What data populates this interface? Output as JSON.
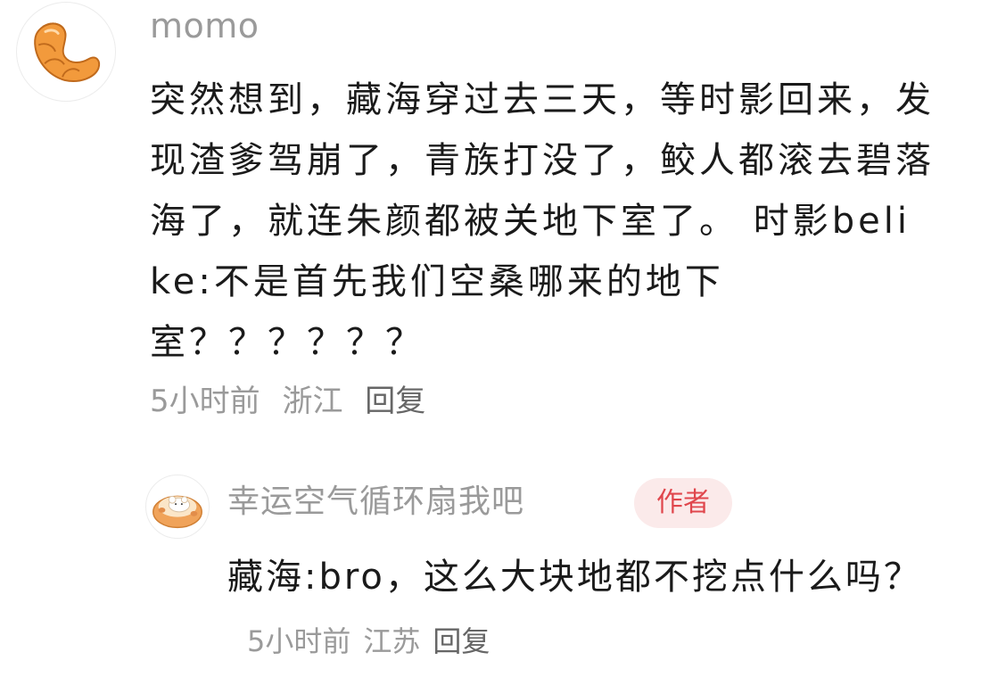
{
  "comment": {
    "username": "momo",
    "text": "突然想到，藏海穿过去三天，等时影回来，发现渣爹驾崩了，青族打没了，鲛人都滚去碧落海了，就连朱颜都被关地下室了。 时影belike:不是首先我们空桑哪来的地下室？？？？？？",
    "time": "5小时前",
    "location": "浙江",
    "reply_label": "回复",
    "avatar_icon": "croissant-icon"
  },
  "reply": {
    "username": "幸运空气循环扇我吧",
    "badge": "作者",
    "text": "藏海:bro，这么大块地都不挖点什么吗？",
    "time": "5小时前",
    "location": "江苏",
    "reply_label": "回复",
    "avatar_icon": "hamster-bread-icon"
  },
  "colors": {
    "username": "#9a9a9a",
    "body_text": "#1a1a1a",
    "badge_bg": "#fbeaea",
    "badge_text": "#e0474d",
    "croissant": "#f29a3c"
  }
}
